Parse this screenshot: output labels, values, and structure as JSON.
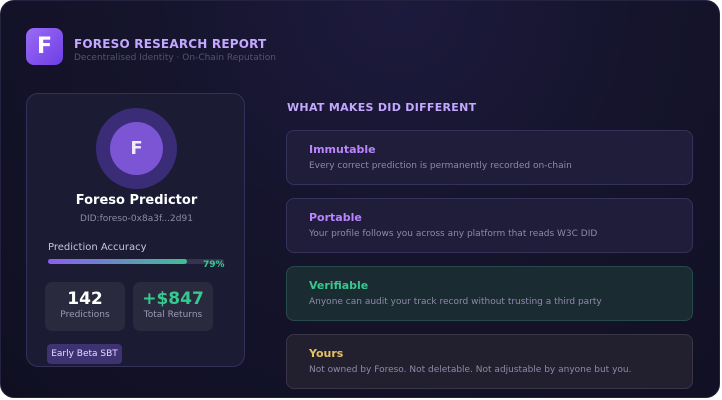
{
  "header": {
    "logo_letter": "F",
    "title": "FORESO RESEARCH REPORT",
    "subtitle": "Decentralised Identity · On-Chain Reputation"
  },
  "profile": {
    "avatar_letter": "F",
    "name": "Foreso Predictor",
    "did": "DID:foreso-0x8a3f...2d91",
    "accuracy_label": "Prediction Accuracy",
    "accuracy_value": "79%",
    "accuracy_fraction": 0.79,
    "stats": [
      {
        "value": "142",
        "label": "Predictions"
      },
      {
        "value": "+$847",
        "label": "Total Returns"
      }
    ],
    "badge": "Early Beta SBT"
  },
  "section": {
    "title": "WHAT MAKES DID DIFFERENT",
    "features": [
      {
        "title": "Immutable",
        "desc": "Every correct prediction is permanently recorded on-chain",
        "accent": "#b985ff"
      },
      {
        "title": "Portable",
        "desc": "Your profile follows you across any platform that reads W3C DID",
        "accent": "#b985ff"
      },
      {
        "title": "Verifiable",
        "desc": "Anyone can audit your track record without trusting a third party",
        "accent": "#36c98f"
      },
      {
        "title": "Yours",
        "desc": "Not owned by Foreso. Not deletable. Not adjustable by anyone but you.",
        "accent": "#e8c063"
      }
    ]
  },
  "colors": {
    "background": "#15142c",
    "brand": "#7b55d4",
    "accent_purple": "#c4a7ff",
    "accent_green": "#36c98f",
    "accent_yellow": "#e8c063"
  }
}
